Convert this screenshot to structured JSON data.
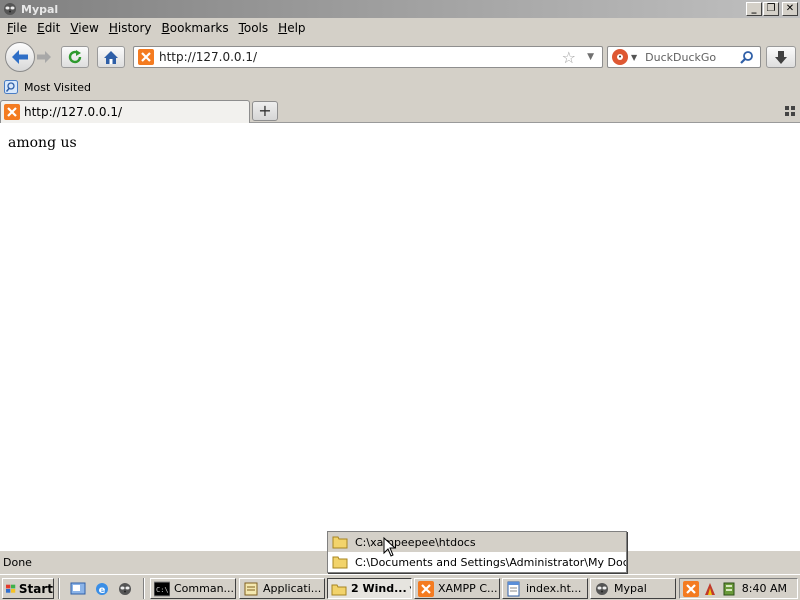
{
  "window": {
    "title": "Mypal"
  },
  "menu": [
    {
      "label": "File",
      "ul": "F",
      "rest": "ile"
    },
    {
      "label": "Edit",
      "ul": "E",
      "rest": "dit"
    },
    {
      "label": "View",
      "ul": "V",
      "rest": "iew"
    },
    {
      "label": "History",
      "ul": "H",
      "rest": "istory"
    },
    {
      "label": "Bookmarks",
      "ul": "B",
      "rest": "ookmarks"
    },
    {
      "label": "Tools",
      "ul": "T",
      "rest": "ools"
    },
    {
      "label": "Help",
      "ul": "H",
      "rest": "elp"
    }
  ],
  "navbar": {
    "url": "http://127.0.0.1/",
    "search_placeholder": "DuckDuckGo"
  },
  "bookmarks": {
    "most_visited": "Most Visited"
  },
  "tabs": [
    {
      "label": "http://127.0.0.1/"
    }
  ],
  "content": {
    "text": "among us"
  },
  "status": {
    "text": "Done"
  },
  "taskbar": {
    "start": "Start",
    "tasks": [
      {
        "label": "Comman..."
      },
      {
        "label": "Applicati..."
      },
      {
        "label": "2 Wind..."
      },
      {
        "label": "XAMPP C..."
      },
      {
        "label": "index.ht..."
      },
      {
        "label": "Mypal"
      }
    ],
    "clock": "8:40 AM"
  },
  "popup": {
    "items": [
      {
        "label": "C:\\xampeepee\\htdocs"
      },
      {
        "label": "C:\\Documents and Settings\\Administrator\\My Docum..."
      }
    ]
  },
  "colors": {
    "accent": "#0a246a",
    "xampp_orange": "#f47b20",
    "ddg": "#de5833"
  }
}
